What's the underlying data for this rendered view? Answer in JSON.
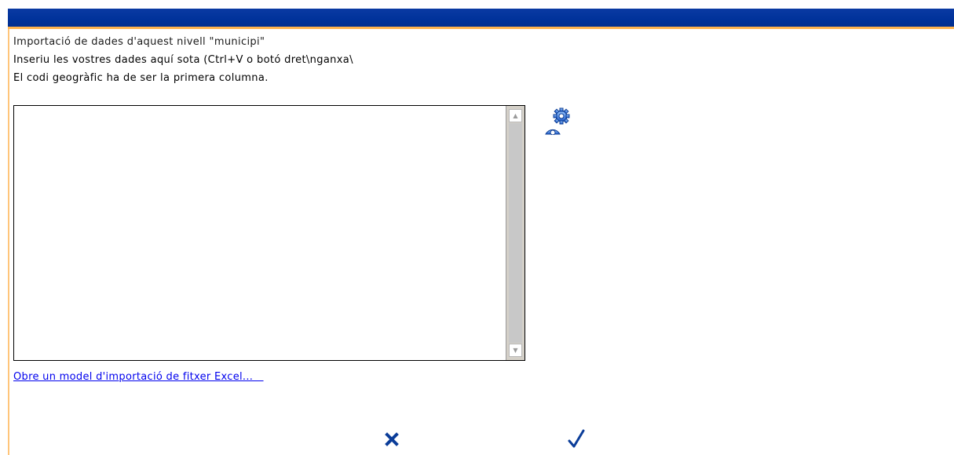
{
  "dialog": {
    "lines": [
      "Importació de dades d'aquest nivell \"municipi\"",
      "Inseriu les vostres dades aquí sota (Ctrl+V o botó dret\\nganxa\\",
      "El codi geogràfic ha de ser la primera columna."
    ],
    "data_input": {
      "value": "",
      "placeholder": ""
    },
    "link_text": "Obre un model d'importació de fitxer Excel...   ",
    "icons": {
      "settings": "gear-settings-icon",
      "cancel": "close-x-icon",
      "confirm": "checkmark-icon"
    }
  },
  "colors": {
    "title_bar": "#00329a",
    "accent_rule": "#ffb34d",
    "link": "#0000ee"
  }
}
